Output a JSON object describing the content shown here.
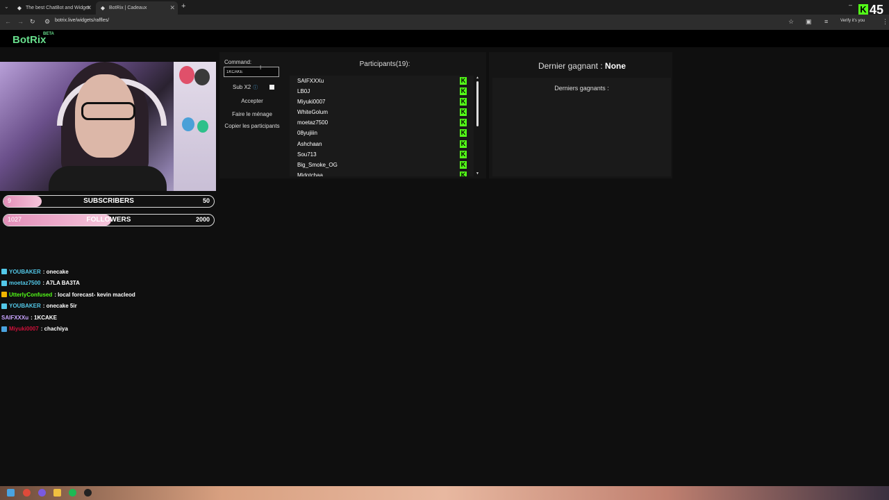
{
  "browser": {
    "tabs": [
      {
        "title": "The best ChatBot and Widget"
      },
      {
        "title": "BotRix | Cadeaux"
      }
    ],
    "url": "botrix.live/widgets/raffles/",
    "verify_label": "Verify it's you"
  },
  "stream_overlay": {
    "kick_count": "45"
  },
  "app": {
    "logo": "BotRix",
    "logo_badge": "BETA"
  },
  "goals": [
    {
      "current": "9",
      "label": "SUBSCRIBERS",
      "target": "50",
      "progress": 0.18
    },
    {
      "current": "1027",
      "label": "FOLLOWERS",
      "target": "2000",
      "progress": 0.51
    }
  ],
  "chat": [
    {
      "user": "YOUBAKER",
      "user_color": "#53c8e8",
      "badge_color": "#53c8e8",
      "message": ": onecake"
    },
    {
      "user": "moetaz7500",
      "user_color": "#53c8e8",
      "badge_color": "#53c8e8",
      "message": ": A7LA BA3TA"
    },
    {
      "user": "UtterlyConfused",
      "user_color": "#53fc18",
      "badge_color": "#f0b400",
      "message": ": local forecast- kevin macleod"
    },
    {
      "user": "YOUBAKER",
      "user_color": "#53c8e8",
      "badge_color": "#53c8e8",
      "message": ": onecake 5ir"
    },
    {
      "user": "SAIFXXXu",
      "user_color": "#c9a4ff",
      "badge_color": "",
      "message": ": 1KCAKE"
    },
    {
      "user": "Miyuki0007",
      "user_color": "#d0103a",
      "badge_color": "#4aa3df",
      "message": ": chachiya"
    }
  ],
  "raffle": {
    "command_label": "Command:",
    "command_value": "1KCAKE",
    "sub_label": "Sub X2",
    "accept_label": "Accepter",
    "cleanup_label": "Faire le ménage",
    "copy_label": "Copier les participants",
    "participants_title": "Participants(19):",
    "participants": [
      "SAIFXXXu",
      "LB0J",
      "Miyuki0007",
      "WhiteGolum",
      "moetaz7500",
      "08yujiiin",
      "Ashchaan",
      "Sou713",
      "Big_Smoke_OG",
      "Midotchaa"
    ]
  },
  "winner": {
    "title_prefix": "Dernier gagnant :",
    "title_value": "None",
    "recent_label": "Derniers gagnants :"
  },
  "colors": {
    "kick_green": "#53fc18",
    "logo_green": "#67df8c",
    "goal_pink": "#e38fb9"
  }
}
